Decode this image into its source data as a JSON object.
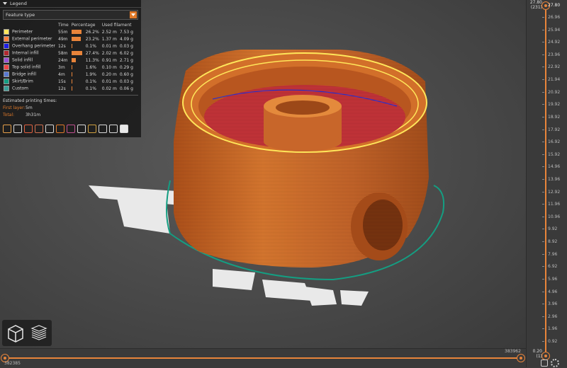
{
  "legend": {
    "title": "Legend",
    "selector": "Feature type",
    "headers": {
      "feature": "",
      "time": "Time",
      "percentage": "Percentage",
      "filament": "Used filament"
    },
    "rows": [
      {
        "name": "Perimeter",
        "color": "#ffe65a",
        "time": "55m",
        "percent_text": "26.2%",
        "percent": 26.2,
        "length": "2.52 m",
        "weight": "7.53 g"
      },
      {
        "name": "External perimeter",
        "color": "#ff7e3c",
        "time": "49m",
        "percent_text": "23.2%",
        "percent": 23.2,
        "length": "1.37 m",
        "weight": "4.09 g"
      },
      {
        "name": "Overhang perimeter",
        "color": "#1e1ee6",
        "time": "12s",
        "percent_text": "0.1%",
        "percent": 0.1,
        "length": "0.01 m",
        "weight": "0.03 g"
      },
      {
        "name": "Internal infill",
        "color": "#b02830",
        "time": "58m",
        "percent_text": "27.4%",
        "percent": 27.4,
        "length": "2.02 m",
        "weight": "6.02 g"
      },
      {
        "name": "Solid infill",
        "color": "#9a52d6",
        "time": "24m",
        "percent_text": "11.3%",
        "percent": 11.3,
        "length": "0.91 m",
        "weight": "2.71 g"
      },
      {
        "name": "Top solid infill",
        "color": "#f04646",
        "time": "3m",
        "percent_text": "1.6%",
        "percent": 1.6,
        "length": "0.10 m",
        "weight": "0.29 g"
      },
      {
        "name": "Bridge infill",
        "color": "#5a7ad2",
        "time": "4m",
        "percent_text": "1.9%",
        "percent": 1.9,
        "length": "0.20 m",
        "weight": "0.60 g"
      },
      {
        "name": "Skirt/Brim",
        "color": "#149e82",
        "time": "15s",
        "percent_text": "0.1%",
        "percent": 0.1,
        "length": "0.01 m",
        "weight": "0.03 g"
      },
      {
        "name": "Custom",
        "color": "#3aa098",
        "time": "12s",
        "percent_text": "0.1%",
        "percent": 0.1,
        "length": "0.02 m",
        "weight": "0.06 g"
      }
    ],
    "estimated_title": "Estimated printing times:",
    "first_layer_label": "First layer:",
    "first_layer_value": "5m",
    "total_label": "Total:",
    "total_value": "3h31m",
    "tool_icons": [
      "travel-icon",
      "wipe-icon",
      "retraction-icon",
      "deretraction-icon",
      "seam-icon",
      "tool-change-icon",
      "color-change-icon",
      "pause-icon",
      "custom-gcode-icon",
      "center-of-gravity-icon",
      "shells-icon",
      "tool-marker-icon"
    ]
  },
  "vertical_slider": {
    "top_value": "27.80",
    "top_layer": "(231)",
    "bottom_value": "0.20",
    "bottom_layer": "(1)",
    "top_thumb_label": "27.80",
    "ticks": [
      "26.96",
      "25.94",
      "24.92",
      "23.96",
      "22.92",
      "21.94",
      "20.92",
      "19.92",
      "18.92",
      "17.92",
      "16.92",
      "15.92",
      "14.96",
      "13.96",
      "12.92",
      "11.96",
      "10.96",
      "9.92",
      "8.92",
      "7.96",
      "6.92",
      "5.96",
      "4.96",
      "3.96",
      "2.96",
      "1.96",
      "0.92"
    ]
  },
  "horizontal_slider": {
    "left_value": "382385",
    "right_value": "383962"
  },
  "view_buttons": [
    "3d-view-icon",
    "layers-view-icon"
  ]
}
